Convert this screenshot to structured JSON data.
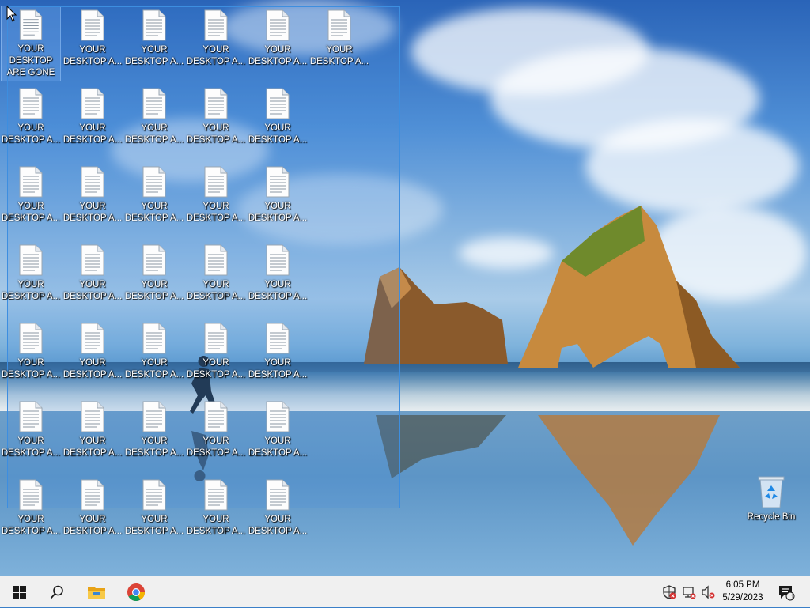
{
  "desktop": {
    "icon_rows": [
      [
        "YOUR DESKTOP ARE GONE",
        "YOUR DESKTOP A...",
        "YOUR DESKTOP A...",
        "YOUR DESKTOP A...",
        "YOUR DESKTOP A...",
        "YOUR DESKTOP A..."
      ],
      [
        "YOUR DESKTOP A...",
        "YOUR DESKTOP A...",
        "YOUR DESKTOP A...",
        "YOUR DESKTOP A...",
        "YOUR DESKTOP A..."
      ],
      [
        "YOUR DESKTOP A...",
        "YOUR DESKTOP A...",
        "YOUR DESKTOP A...",
        "YOUR DESKTOP A...",
        "YOUR DESKTOP A..."
      ],
      [
        "YOUR DESKTOP A...",
        "YOUR DESKTOP A...",
        "YOUR DESKTOP A...",
        "YOUR DESKTOP A...",
        "YOUR DESKTOP A..."
      ],
      [
        "YOUR DESKTOP A...",
        "YOUR DESKTOP A...",
        "YOUR DESKTOP A...",
        "YOUR DESKTOP A...",
        "YOUR DESKTOP A..."
      ],
      [
        "YOUR DESKTOP A...",
        "YOUR DESKTOP A...",
        "YOUR DESKTOP A...",
        "YOUR DESKTOP A...",
        "YOUR DESKTOP A..."
      ],
      [
        "YOUR DESKTOP A...",
        "YOUR DESKTOP A...",
        "YOUR DESKTOP A...",
        "YOUR DESKTOP A...",
        "YOUR DESKTOP A..."
      ]
    ],
    "icon_type": "text-document-icon",
    "recycle_bin_label": "Recycle Bin"
  },
  "taskbar": {
    "start_icon": "windows-logo-icon",
    "search_icon": "search-icon",
    "pinned": [
      {
        "name": "file-explorer-icon"
      },
      {
        "name": "chrome-icon"
      }
    ],
    "tray_icons": [
      "security-warning-icon",
      "network-disconnected-icon",
      "volume-muted-icon"
    ],
    "clock": {
      "time": "6:05 PM",
      "date": "5/29/2023"
    },
    "notifications": {
      "icon": "action-center-icon",
      "count": "1"
    }
  },
  "colors": {
    "selection_border": "#3d8ee0",
    "taskbar_bg": "#f0f0f0",
    "alert_red": "#d32f2f"
  }
}
